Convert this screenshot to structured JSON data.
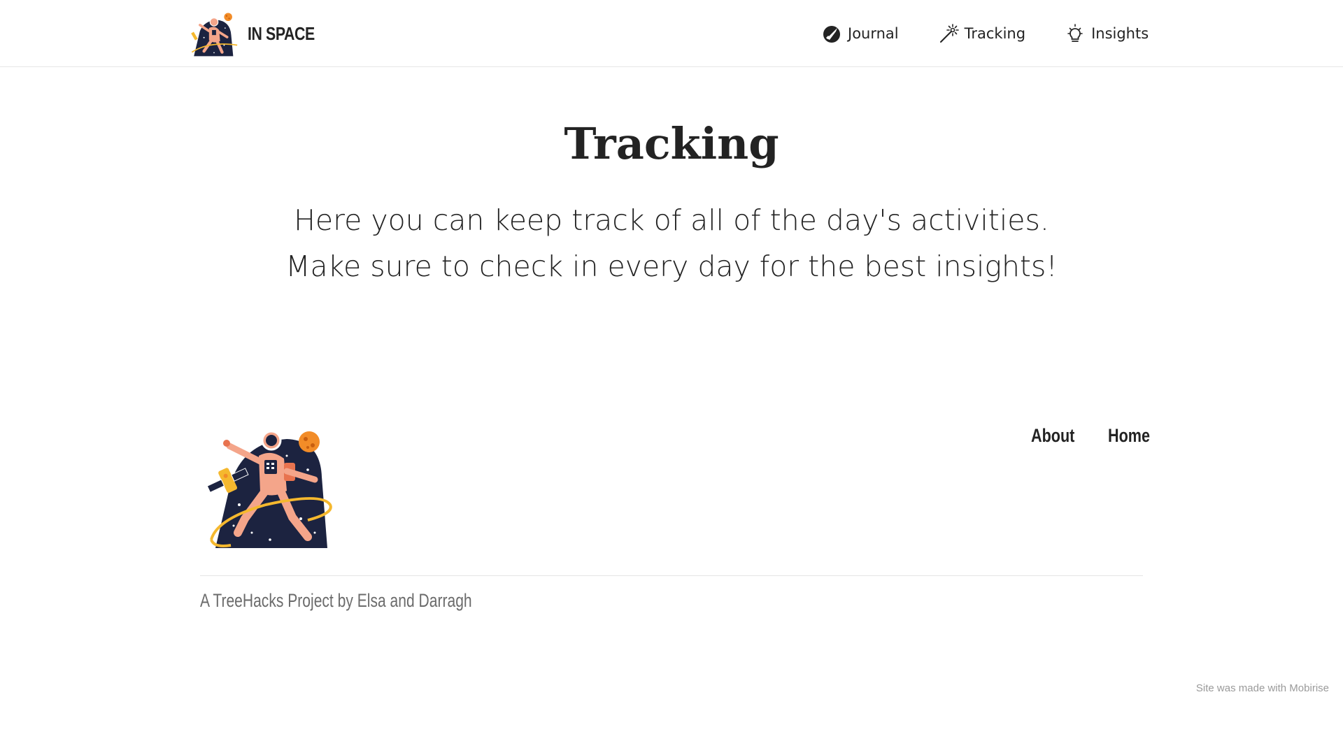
{
  "navbar": {
    "brand": {
      "name": "IN SPACE",
      "logo_icon": "astronaut-logo"
    },
    "links": [
      {
        "label": "Journal",
        "icon": "rocket-badge-icon"
      },
      {
        "label": "Tracking",
        "icon": "magic-wand-icon"
      },
      {
        "label": "Insights",
        "icon": "lightbulb-icon"
      }
    ]
  },
  "header": {
    "title": "Tracking",
    "text": "Here you can keep track of all of the day's activities. Make sure to check in every day for the best insights!"
  },
  "footer": {
    "logo_icon": "astronaut-illustration",
    "links": [
      {
        "label": "About"
      },
      {
        "label": "Home"
      }
    ],
    "credit": "A TreeHacks Project by Elsa and Darragh"
  },
  "made_with": "Site was made with Mobirise",
  "colors": {
    "text": "#232323",
    "muted": "#6b6b6b",
    "astronaut_suit": "#f4a58a",
    "space_navy": "#1c2340",
    "accent_yellow": "#f5b82e",
    "planet_orange": "#f28c28"
  }
}
